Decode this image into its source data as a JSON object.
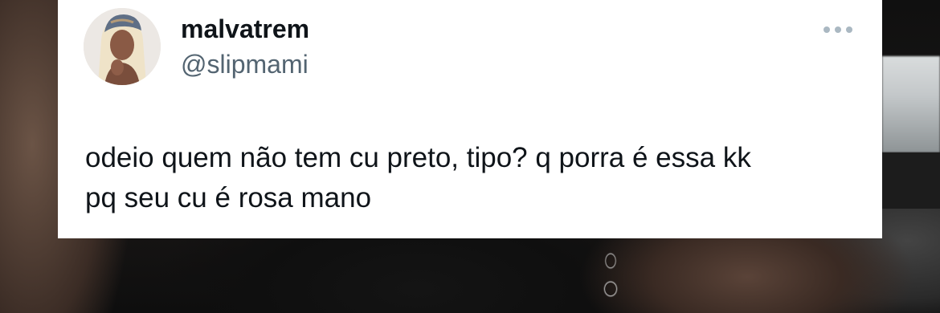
{
  "tweet": {
    "display_name": "malvatrem",
    "handle": "@slipmami",
    "text_lines": [
      "odeio quem não tem cu preto, tipo? q porra é essa kk",
      "pq seu cu é rosa mano"
    ]
  },
  "icons": {
    "more": "more-dots-icon",
    "avatar": "profile-photo"
  },
  "colors": {
    "card_background": "#ffffff",
    "name_text": "#0f1419",
    "handle_text": "#536471",
    "more_icon": "#aab8c2"
  }
}
